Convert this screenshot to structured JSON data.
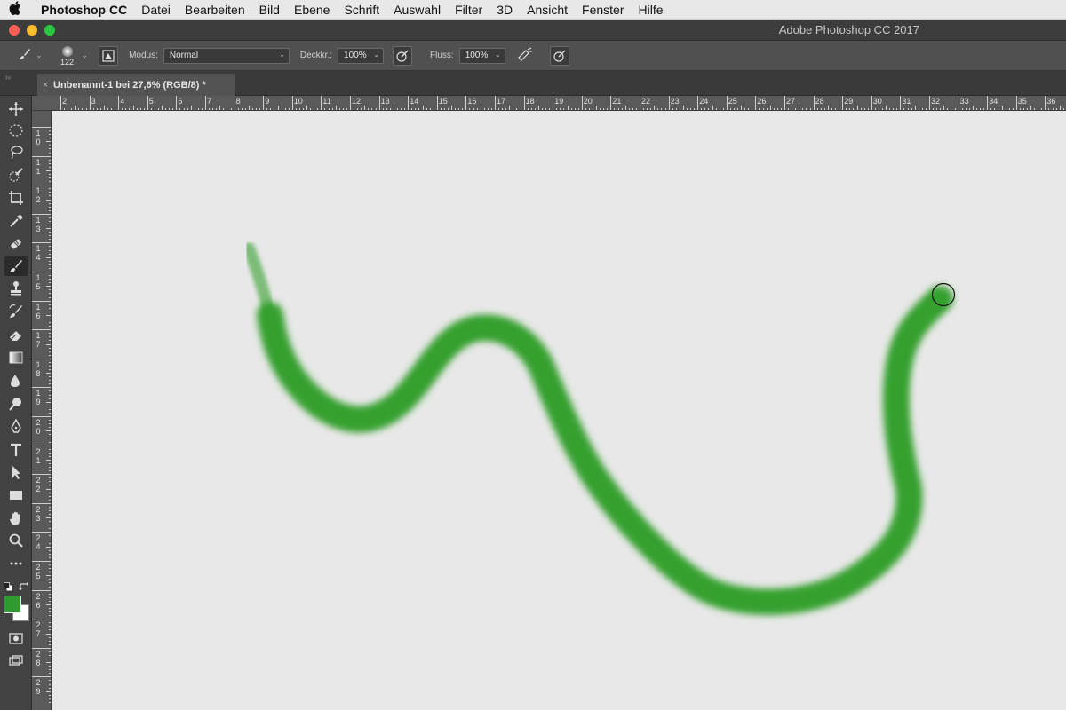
{
  "menubar": {
    "apple_icon": "apple-icon",
    "app_name": "Photoshop CC",
    "items": [
      "Datei",
      "Bearbeiten",
      "Bild",
      "Ebene",
      "Schrift",
      "Auswahl",
      "Filter",
      "3D",
      "Ansicht",
      "Fenster",
      "Hilfe"
    ]
  },
  "window": {
    "title": "Adobe Photoshop CC 2017"
  },
  "options_bar": {
    "brush_size": "122",
    "mode_label": "Modus:",
    "mode_value": "Normal",
    "opacity_label": "Deckkr.:",
    "opacity_value": "100%",
    "flow_label": "Fluss:",
    "flow_value": "100%"
  },
  "document_tab": {
    "title": "Unbenannt-1 bei 27,6% (RGB/8) *",
    "close_glyph": "×"
  },
  "rulers": {
    "top_labels": [
      "2",
      "3",
      "4",
      "5",
      "6",
      "7",
      "8",
      "9",
      "10",
      "11",
      "12",
      "13",
      "14",
      "15",
      "16",
      "17",
      "18",
      "19",
      "20",
      "21",
      "22",
      "23",
      "24",
      "25",
      "26",
      "27",
      "28",
      "29",
      "30",
      "31",
      "32",
      "33",
      "34",
      "35",
      "36"
    ],
    "left_labels": [
      "10",
      "11",
      "12",
      "13",
      "14",
      "15",
      "16",
      "17",
      "18",
      "19",
      "20",
      "21",
      "22",
      "23",
      "24",
      "25",
      "26",
      "27",
      "28",
      "29"
    ]
  },
  "toolbar": {
    "tools": [
      "move-tool",
      "marquee-tool",
      "lasso-tool",
      "quick-selection-tool",
      "crop-tool",
      "eyedropper-tool",
      "healing-brush-tool",
      "brush-tool",
      "clone-stamp-tool",
      "history-brush-tool",
      "eraser-tool",
      "gradient-tool",
      "blur-tool",
      "dodge-tool",
      "pen-tool",
      "type-tool",
      "path-selection-tool",
      "rectangle-tool",
      "hand-tool",
      "zoom-tool",
      "more-tools"
    ],
    "active_tool": "brush-tool",
    "foreground_color": "#2f9a2f",
    "background_color": "#ffffff"
  },
  "canvas": {
    "background_color": "#e8e8e8",
    "stroke_color": "#35a02f"
  }
}
